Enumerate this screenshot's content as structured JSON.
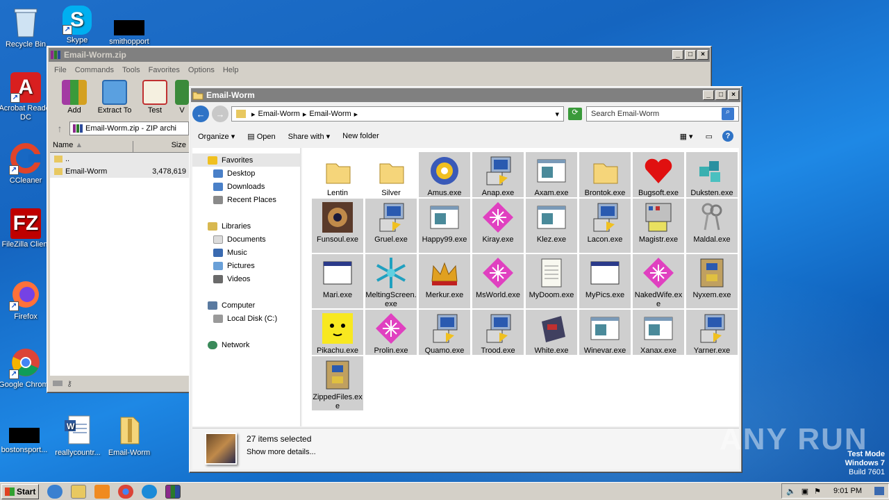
{
  "desktop": {
    "icons": [
      {
        "label": "Recycle Bin",
        "icon": "recycle-bin-icon"
      },
      {
        "label": "Skype",
        "icon": "skype-icon"
      },
      {
        "label": "smithopport",
        "icon": "blank-file-icon"
      },
      {
        "label": "Acrobat Reader DC",
        "icon": "acrobat-icon"
      },
      {
        "label": "CCleaner",
        "icon": "ccleaner-icon"
      },
      {
        "label": "FileZilla Client",
        "icon": "filezilla-icon"
      },
      {
        "label": "Firefox",
        "icon": "firefox-icon"
      },
      {
        "label": "Google Chrome",
        "icon": "chrome-icon"
      },
      {
        "label": "bostonsport...",
        "icon": "blank-file-icon"
      },
      {
        "label": "reallycountr...",
        "icon": "word-icon"
      },
      {
        "label": "Email-Worm",
        "icon": "folder-zip-icon"
      }
    ]
  },
  "winrar": {
    "title": "Email-Worm.zip",
    "menu": [
      "File",
      "Commands",
      "Tools",
      "Favorites",
      "Options",
      "Help"
    ],
    "toolbar": [
      "Add",
      "Extract To",
      "Test",
      "V"
    ],
    "path": "Email-Worm.zip - ZIP archi",
    "columns": {
      "name": "Name",
      "size": "Size"
    },
    "rows": [
      {
        "name": "..",
        "size": ""
      },
      {
        "name": "Email-Worm",
        "size": "3,478,619"
      }
    ]
  },
  "explorer": {
    "title": "Email-Worm",
    "breadcrumb": [
      "Email-Worm",
      "Email-Worm"
    ],
    "search_placeholder": "Search Email-Worm",
    "commands": [
      "Organize",
      "Open",
      "Share with",
      "New folder"
    ],
    "nav": {
      "favorites": "Favorites",
      "favorites_items": [
        "Desktop",
        "Downloads",
        "Recent Places"
      ],
      "libraries": "Libraries",
      "library_items": [
        "Documents",
        "Music",
        "Pictures",
        "Videos"
      ],
      "computer": "Computer",
      "computer_items": [
        "Local Disk (C:)"
      ],
      "network": "Network"
    },
    "files": [
      {
        "name": "Lentin",
        "icon": "folder-icon",
        "selected": false
      },
      {
        "name": "Silver",
        "icon": "folder-icon",
        "selected": false
      },
      {
        "name": "Amus.exe",
        "icon": "disc-icon",
        "selected": true
      },
      {
        "name": "Anap.exe",
        "icon": "setup-icon",
        "selected": true
      },
      {
        "name": "Axam.exe",
        "icon": "window-icon",
        "selected": true
      },
      {
        "name": "Brontok.exe",
        "icon": "folder-icon",
        "selected": true
      },
      {
        "name": "Bugsoft.exe",
        "icon": "heart-icon",
        "selected": true
      },
      {
        "name": "Duksten.exe",
        "icon": "cubes-icon",
        "selected": true
      },
      {
        "name": "Funsoul.exe",
        "icon": "photo-icon",
        "selected": true
      },
      {
        "name": "Gruel.exe",
        "icon": "setup-icon",
        "selected": true
      },
      {
        "name": "Happy99.exe",
        "icon": "window-icon",
        "selected": true
      },
      {
        "name": "Kiray.exe",
        "icon": "pink-diamond-icon",
        "selected": true
      },
      {
        "name": "Klez.exe",
        "icon": "window-icon",
        "selected": true
      },
      {
        "name": "Lacon.exe",
        "icon": "setup-icon",
        "selected": true
      },
      {
        "name": "Magistr.exe",
        "icon": "app-box-icon",
        "selected": true
      },
      {
        "name": "Maldal.exe",
        "icon": "keys-icon",
        "selected": true
      },
      {
        "name": "Mari.exe",
        "icon": "blank-window-icon",
        "selected": true
      },
      {
        "name": "MeltingScreen.exe",
        "icon": "snowflake-icon",
        "selected": true
      },
      {
        "name": "Merkur.exe",
        "icon": "crown-icon",
        "selected": true
      },
      {
        "name": "MsWorld.exe",
        "icon": "pink-diamond-icon",
        "selected": true
      },
      {
        "name": "MyDoom.exe",
        "icon": "notepad-icon",
        "selected": true
      },
      {
        "name": "MyPics.exe",
        "icon": "blank-window-icon",
        "selected": true
      },
      {
        "name": "NakedWife.exe",
        "icon": "pink-diamond-icon",
        "selected": true
      },
      {
        "name": "Nyxem.exe",
        "icon": "archive-icon",
        "selected": true
      },
      {
        "name": "Pikachu.exe",
        "icon": "pikachu-icon",
        "selected": true
      },
      {
        "name": "Prolin.exe",
        "icon": "pink-diamond-icon",
        "selected": true
      },
      {
        "name": "Quamo.exe",
        "icon": "setup-icon",
        "selected": true
      },
      {
        "name": "Trood.exe",
        "icon": "setup-icon",
        "selected": true
      },
      {
        "name": "White.exe",
        "icon": "floppy-icon",
        "selected": true
      },
      {
        "name": "Winevar.exe",
        "icon": "window-icon",
        "selected": true
      },
      {
        "name": "Xanax.exe",
        "icon": "window-icon",
        "selected": true
      },
      {
        "name": "Yarner.exe",
        "icon": "setup-icon",
        "selected": true
      },
      {
        "name": "ZippedFiles.exe",
        "icon": "archive-icon",
        "selected": true
      }
    ],
    "status": {
      "count": "27 items selected",
      "details": "Show more details..."
    }
  },
  "taskbar": {
    "start": "Start",
    "time": "9:01 PM"
  },
  "watermark": {
    "line1": "Test Mode",
    "line2": "Windows 7",
    "line3": "Build 7601",
    "brand": "ANY RUN"
  },
  "colors": {
    "selection": "#cfcfcf",
    "titlebar_inactive": "#808080",
    "classic_face": "#d4d0c8"
  }
}
